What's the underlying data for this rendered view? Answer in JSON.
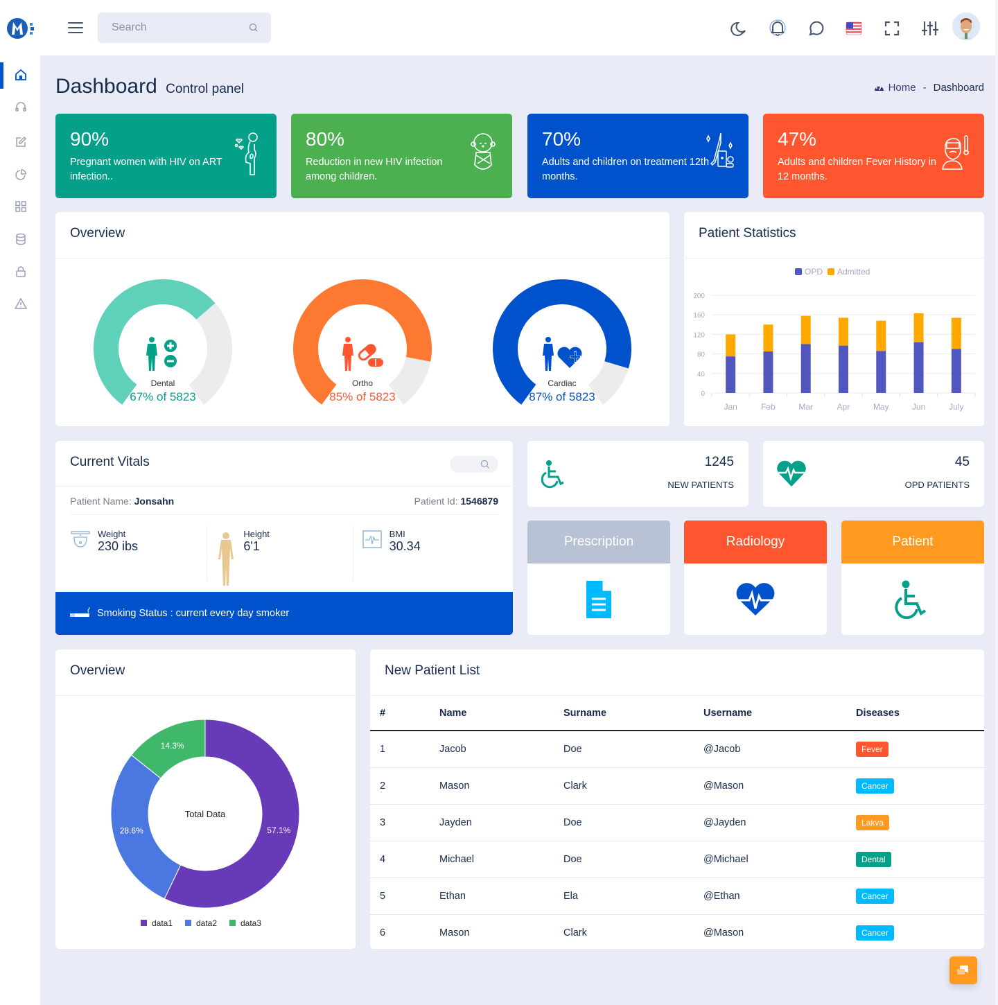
{
  "header": {
    "search_placeholder": "Search",
    "icons": [
      "menu-icon",
      "search-icon",
      "moon-icon",
      "bell-icon",
      "chat-icon",
      "us-flag-icon",
      "fullscreen-icon",
      "sliders-icon",
      "avatar"
    ]
  },
  "sidebar": {
    "items": [
      {
        "icon": "home-icon",
        "active": true
      },
      {
        "icon": "headphones-icon"
      },
      {
        "icon": "edit-icon"
      },
      {
        "icon": "pie-chart-icon"
      },
      {
        "icon": "grid-icon"
      },
      {
        "icon": "database-icon"
      },
      {
        "icon": "lock-icon"
      },
      {
        "icon": "alert-triangle-icon"
      }
    ]
  },
  "page": {
    "title": "Dashboard",
    "subtitle": "Control panel",
    "breadcrumb": {
      "home": "Home",
      "separator": "-",
      "current": "Dashboard"
    }
  },
  "stats": [
    {
      "pct": "90%",
      "desc": "Pregnant women with HIV on ART infection..",
      "color": "#05a08a",
      "icon": "pregnant-woman-icon"
    },
    {
      "pct": "80%",
      "desc": "Reduction in new HIV infection among children.",
      "color": "#4cb050",
      "icon": "baby-icon"
    },
    {
      "pct": "70%",
      "desc": "Adults and children on treatment 12th months.",
      "color": "#0052cc",
      "icon": "medicine-icon"
    },
    {
      "pct": "47%",
      "desc": "Adults and children Fever History in 12 months.",
      "color": "#ff562f",
      "icon": "fever-icon"
    }
  ],
  "overview": {
    "title": "Overview",
    "gauges": [
      {
        "label": "Dental",
        "value_text": "67% of 5823",
        "percent": 67,
        "color": "#5fd0b9",
        "text_color": "#05a08a",
        "icon_color": "#05a08a"
      },
      {
        "label": "Ortho",
        "value_text": "85% of 5823",
        "percent": 85,
        "color": "#fd7831",
        "text_color": "#ff562f",
        "icon_color": "#ff562f"
      },
      {
        "label": "Cardiac",
        "value_text": "87% of 5823",
        "percent": 87,
        "color": "#0052cc",
        "text_color": "#0052cc",
        "icon_color": "#0052cc"
      }
    ]
  },
  "patient_statistics": {
    "title": "Patient Statistics"
  },
  "chart_data": {
    "type": "bar",
    "stacked": true,
    "title": "Patient Statistics",
    "categories": [
      "Jan",
      "Feb",
      "Mar",
      "Apr",
      "May",
      "Jun",
      "July"
    ],
    "series": [
      {
        "name": "OPD",
        "color": "#5157bf",
        "values": [
          75,
          85,
          100,
          97,
          86,
          104,
          90
        ]
      },
      {
        "name": "Admitted",
        "color": "#ffa800",
        "values": [
          45,
          55,
          58,
          57,
          62,
          59,
          64
        ]
      }
    ],
    "yticks": [
      0,
      40,
      80,
      120,
      160,
      200
    ],
    "ylim": [
      0,
      200
    ],
    "legend": "top-center",
    "grid": true
  },
  "vitals": {
    "title": "Current Vitals",
    "patient_name_label": "Patient Name:",
    "patient_name": "Jonsahn",
    "patient_id_label": "Patient Id:",
    "patient_id": "1546879",
    "weight_label": "Weight",
    "weight": "230 ibs",
    "height_label": "Height",
    "height": "6'1",
    "bmi_label": "BMI",
    "bmi": "30.34",
    "smoking": "Smoking Status : current every day smoker"
  },
  "quick": [
    {
      "num": "1245",
      "label": "NEW PATIENTS"
    },
    {
      "num": "45",
      "label": "OPD PATIENTS"
    }
  ],
  "tiles": [
    {
      "label": "Prescription",
      "color": "#b8c2d4"
    },
    {
      "label": "Radiology",
      "color": "#ff562f"
    },
    {
      "label": "Patient",
      "color": "#ff9920"
    }
  ],
  "donut": {
    "title": "Overview",
    "center_label": "Total Data",
    "slices": [
      {
        "name": "data1",
        "value": 57.1,
        "label": "57.1%",
        "color": "#673ab7"
      },
      {
        "name": "data2",
        "value": 28.6,
        "label": "28.6%",
        "color": "#4b77e0"
      },
      {
        "name": "data3",
        "value": 14.3,
        "label": "14.3%",
        "color": "#3fb86b"
      }
    ]
  },
  "patient_list": {
    "title": "New Patient List",
    "columns": [
      "#",
      "Name",
      "Surname",
      "Username",
      "Diseases"
    ],
    "rows": [
      {
        "n": "1",
        "name": "Jacob",
        "surname": "Doe",
        "username": "@Jacob",
        "disease": "Fever",
        "color": "#ff562f"
      },
      {
        "n": "2",
        "name": "Mason",
        "surname": "Clark",
        "username": "@Mason",
        "disease": "Cancer",
        "color": "#00baff"
      },
      {
        "n": "3",
        "name": "Jayden",
        "surname": "Doe",
        "username": "@Jayden",
        "disease": "Lakva",
        "color": "#ff9920"
      },
      {
        "n": "4",
        "name": "Michael",
        "surname": "Doe",
        "username": "@Michael",
        "disease": "Dental",
        "color": "#05a08a"
      },
      {
        "n": "5",
        "name": "Ethan",
        "surname": "Ela",
        "username": "@Ethan",
        "disease": "Cancer",
        "color": "#00baff"
      },
      {
        "n": "6",
        "name": "Mason",
        "surname": "Clark",
        "username": "@Mason",
        "disease": "Cancer",
        "color": "#00baff"
      }
    ]
  }
}
